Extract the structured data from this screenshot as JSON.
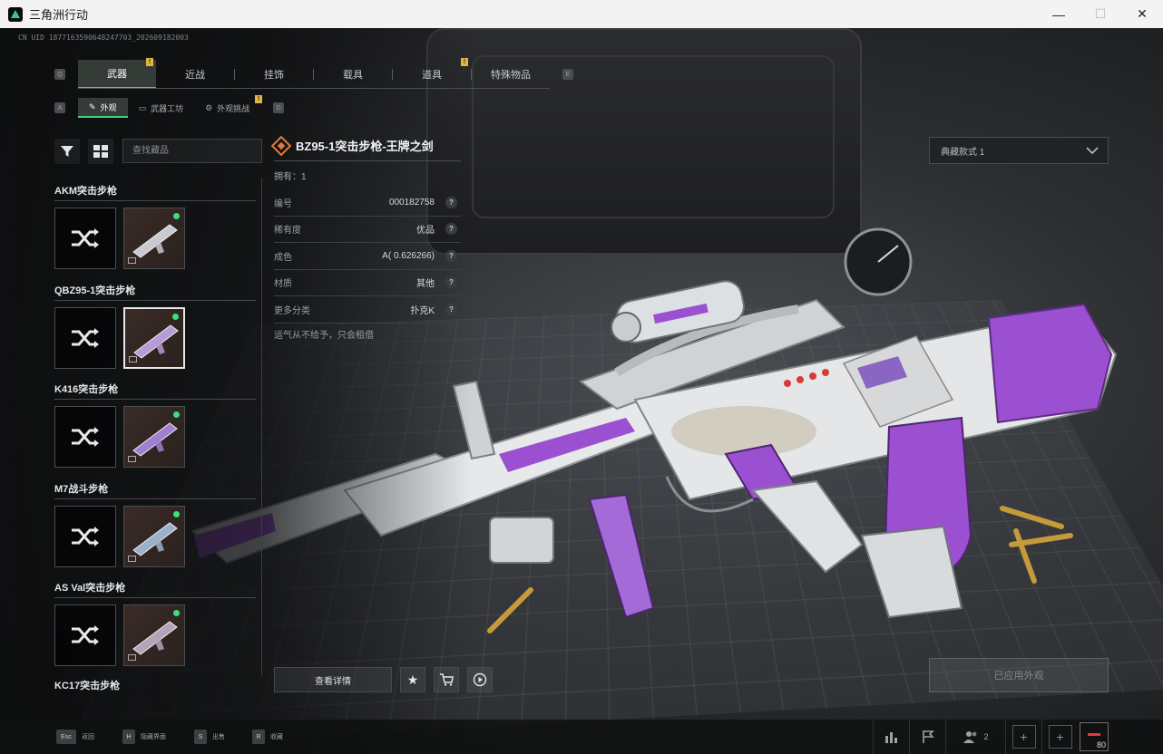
{
  "window": {
    "title": "三角洲行动",
    "controls": {
      "minimize": "—",
      "maximize": "☐",
      "close": "✕"
    }
  },
  "uid": "CN UID 1877163590648247703_202609182003",
  "tabs": {
    "left_key": "Q",
    "right_key": "E",
    "items": [
      {
        "label": "武器",
        "active": true,
        "badge": "!"
      },
      {
        "label": "近战",
        "active": false
      },
      {
        "label": "挂饰",
        "active": false
      },
      {
        "label": "载具",
        "active": false
      },
      {
        "label": "道具",
        "active": false,
        "badge": "!"
      },
      {
        "label": "特殊物品",
        "active": false
      }
    ]
  },
  "subtabs": {
    "left_key": "A",
    "right_key": "D",
    "items": [
      {
        "label": "外观",
        "active": true
      },
      {
        "label": "武器工坊",
        "active": false
      },
      {
        "label": "外观挑战",
        "active": false,
        "badge": "!"
      }
    ]
  },
  "search": {
    "placeholder": "查找藏品"
  },
  "weapon_groups": [
    {
      "name": "AKM突击步枪",
      "selected": false,
      "tint": "#c9c9cf"
    },
    {
      "name": "QBZ95-1突击步枪",
      "selected": true,
      "tint": "#b79ad6"
    },
    {
      "name": "K416突击步枪",
      "selected": false,
      "tint": "#a07fd0"
    },
    {
      "name": "M7战斗步枪",
      "selected": false,
      "tint": "#9bb1c9"
    },
    {
      "name": "AS Val突击步枪",
      "selected": false,
      "tint": "#b6a3b8"
    }
  ],
  "last_group": "KC17突击步枪",
  "detail": {
    "name": "BZ95-1突击步枪-王牌之剑",
    "owned": "拥有：1",
    "attributes": [
      {
        "key": "编号",
        "value": "000182758"
      },
      {
        "key": "稀有度",
        "value": "优品"
      },
      {
        "key": "成色",
        "value": "A( 0.626266)"
      },
      {
        "key": "材质",
        "value": "其他"
      },
      {
        "key": "更多分类",
        "value": "扑克K"
      }
    ],
    "flavor": "运气从不给予，只会租借",
    "view_details": "查看详情",
    "help": "?"
  },
  "right": {
    "dropdown": "典藏款式 1",
    "apply": "已应用外观"
  },
  "bottom_hints": [
    {
      "key": "Esc",
      "label": "返回"
    },
    {
      "key": "H",
      "label": "隐藏界面"
    },
    {
      "key": "S",
      "label": "出售"
    },
    {
      "key": "R",
      "label": "收藏"
    }
  ],
  "bottom_right": {
    "team_count": "2",
    "plus": "+",
    "level": "80"
  },
  "colors": {
    "accent_green": "#43d27f",
    "badge_yellow": "#e2b542",
    "rarity_orange": "#e07a3c",
    "skin_purple": "#9b4fd1"
  }
}
